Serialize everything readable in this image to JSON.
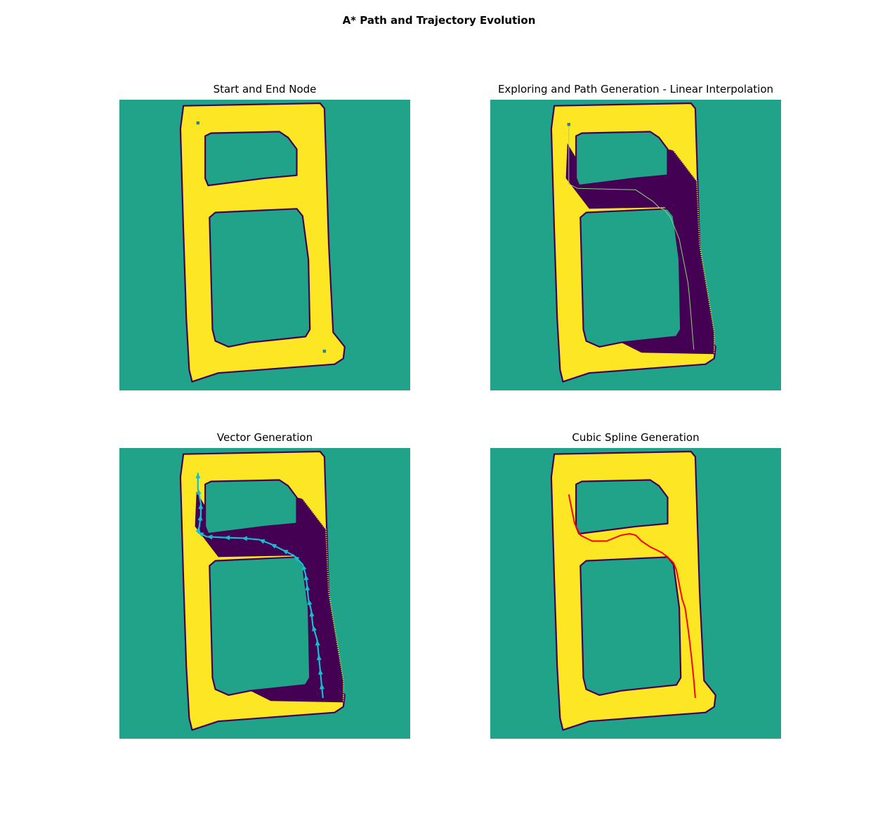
{
  "figure": {
    "suptitle": "A* Path and Trajectory Evolution"
  },
  "colors": {
    "background": "#21a38a",
    "track": "#fde725",
    "explored": "#440154",
    "outline": "#440154",
    "node": "#2a7fa0",
    "linear_path": "#8fd17f",
    "vector": "#17becf",
    "spline": "#ff0000"
  },
  "chart_data": [
    {
      "type": "heatmap",
      "title": "Start and End Node",
      "grid_size": [
        100,
        100
      ],
      "start_node": [
        27,
        8
      ],
      "end_node": [
        70.5,
        86.5
      ]
    },
    {
      "type": "heatmap",
      "title": "Exploring and Path Generation - Linear Interpolation",
      "grid_size": [
        100,
        100
      ],
      "start_node": [
        27,
        8.5
      ],
      "path": [
        [
          27,
          8.5
        ],
        [
          27,
          29
        ],
        [
          30,
          30.5
        ],
        [
          50,
          31
        ],
        [
          56,
          35
        ],
        [
          58,
          37
        ],
        [
          60,
          38
        ],
        [
          62,
          40.5
        ],
        [
          63,
          43
        ],
        [
          65,
          48
        ],
        [
          66,
          53
        ],
        [
          67,
          58
        ],
        [
          68,
          63
        ],
        [
          68.5,
          68
        ],
        [
          69,
          74
        ],
        [
          69.5,
          80
        ],
        [
          70,
          86
        ]
      ]
    },
    {
      "type": "line",
      "title": "Vector Generation",
      "grid_size": [
        100,
        100
      ],
      "vectors": [
        [
          27,
          8.5
        ],
        [
          27,
          14
        ],
        [
          28,
          19
        ],
        [
          28,
          23
        ],
        [
          27.5,
          27
        ],
        [
          27,
          29
        ],
        [
          30,
          30.5
        ],
        [
          36,
          30.8
        ],
        [
          42,
          31
        ],
        [
          48,
          31.5
        ],
        [
          52,
          33
        ],
        [
          56,
          35
        ],
        [
          60,
          37
        ],
        [
          63,
          40
        ],
        [
          64,
          43.5
        ],
        [
          64.5,
          47
        ],
        [
          65,
          52
        ],
        [
          66,
          56
        ],
        [
          66.5,
          61
        ],
        [
          68,
          66
        ],
        [
          68.5,
          71
        ],
        [
          69,
          76
        ],
        [
          69.5,
          81
        ],
        [
          70,
          86
        ]
      ]
    },
    {
      "type": "line",
      "title": "Cubic Spline Generation",
      "grid_size": [
        100,
        100
      ],
      "spline": [
        [
          27,
          16
        ],
        [
          28,
          21
        ],
        [
          29,
          26
        ],
        [
          31,
          30
        ],
        [
          35,
          32
        ],
        [
          40,
          32
        ],
        [
          45,
          30
        ],
        [
          48,
          29.5
        ],
        [
          50,
          30
        ],
        [
          52,
          32
        ],
        [
          55,
          34
        ],
        [
          57,
          35
        ],
        [
          59,
          36
        ],
        [
          61,
          37.5
        ],
        [
          63,
          39.5
        ],
        [
          64,
          42
        ],
        [
          65,
          47
        ],
        [
          66,
          52
        ],
        [
          67,
          55
        ],
        [
          68,
          62
        ],
        [
          68.5,
          66
        ],
        [
          69.3,
          73
        ],
        [
          70,
          80
        ],
        [
          70.5,
          86
        ]
      ]
    }
  ]
}
